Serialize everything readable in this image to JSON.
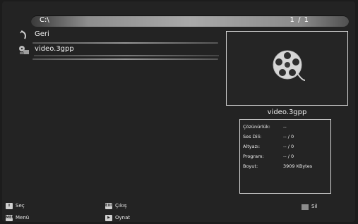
{
  "path_bar": {
    "path": "C:\\",
    "page_indicator": "1 / 1"
  },
  "file_list": [
    {
      "label": "Geri",
      "icon": "back-arrow-icon"
    },
    {
      "label": "video.3gpp",
      "icon": "video-file-icon"
    }
  ],
  "preview": {
    "icon": "film-reel-icon",
    "filename": "video.3gpp"
  },
  "info": {
    "resolution_label": "Çözünürlük:",
    "resolution_value": "--",
    "audio_label": "Ses Dili:",
    "audio_value": "-- / 0",
    "subtitle_label": "Altyazı:",
    "subtitle_value": "-- / 0",
    "program_label": "Program:",
    "program_value": "-- / 0",
    "size_label": "Boyut:",
    "size_value": "3909 KBytes"
  },
  "footer": {
    "select_key": "⇕",
    "select_label": "Seç",
    "exit_key": "EXIT",
    "exit_label": "Çıkış",
    "menu_key": "MENU",
    "menu_label": "Menü",
    "play_key": "▶",
    "play_label": "Oynat",
    "delete_label": "Sil"
  },
  "colors": {
    "background": "#232323",
    "text": "#e8e8e8",
    "delete_key": "#8c8c8c"
  }
}
